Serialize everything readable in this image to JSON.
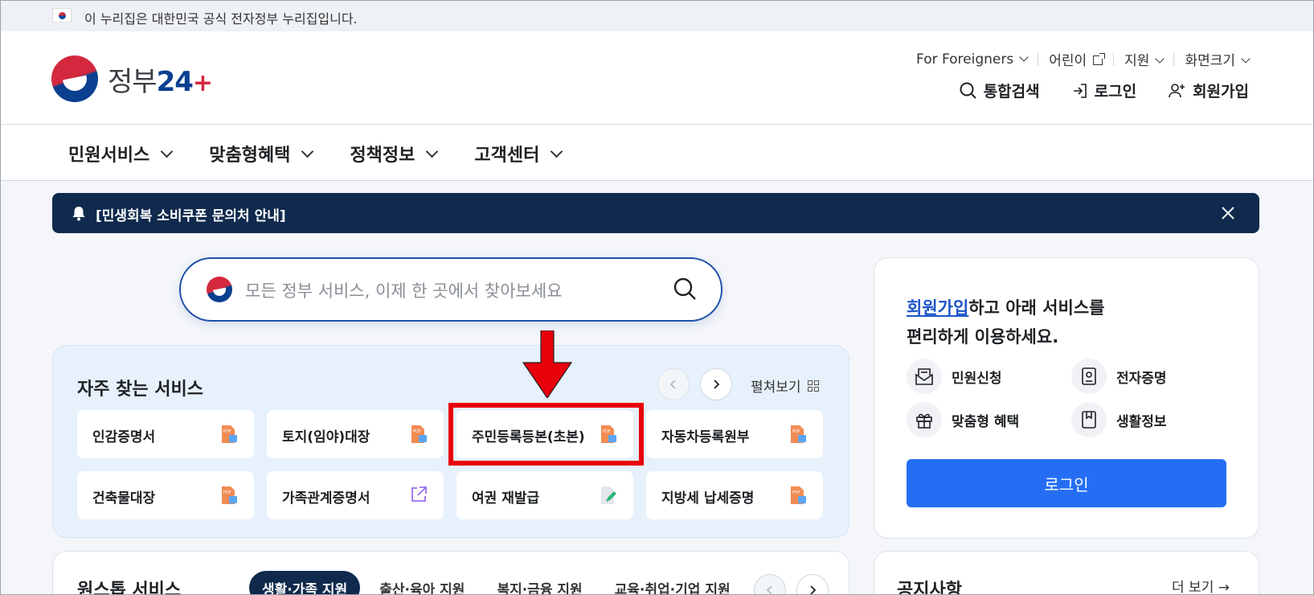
{
  "official_banner": {
    "text": "이 누리집은 대한민국 공식 전자정부 누리집입니다."
  },
  "logo": {
    "text": "정부",
    "number": "24"
  },
  "util_menu": {
    "foreigners": "For Foreigners",
    "kids": "어린이",
    "support": "지원",
    "font_size": "화면크기"
  },
  "auth": {
    "search": "통합검색",
    "login": "로그인",
    "signup": "회원가입"
  },
  "gnb": [
    "민원서비스",
    "맞춤형혜택",
    "정책정보",
    "고객센터"
  ],
  "notice_bar": {
    "text": "[민생회복 소비쿠폰 문의처 안내]"
  },
  "search": {
    "placeholder": "모든 정부 서비스, 이제 한 곳에서 찾아보세요"
  },
  "frequent": {
    "title": "자주 찾는 서비스",
    "expand": "펼쳐보기",
    "tiles": [
      {
        "label": "인감증명서",
        "icon": "pdf-doc-icon"
      },
      {
        "label": "토지(임야)대장",
        "icon": "pdf-doc-icon"
      },
      {
        "label": "주민등록등본(초본)",
        "icon": "pdf-doc-icon"
      },
      {
        "label": "자동차등록원부",
        "icon": "pdf-doc-icon"
      },
      {
        "label": "건축물대장",
        "icon": "pdf-doc-icon"
      },
      {
        "label": "가족관계증명서",
        "icon": "external-link-icon"
      },
      {
        "label": "여권 재발급",
        "icon": "edit-doc-icon"
      },
      {
        "label": "지방세 납세증명",
        "icon": "pdf-doc-icon"
      }
    ]
  },
  "login_card": {
    "link": "회원가입",
    "line1_rest": "하고 아래 서비스를",
    "line2": "편리하게 이용하세요.",
    "services": [
      "민원신청",
      "전자증명",
      "맞춤형 혜택",
      "생활정보"
    ],
    "button": "로그인"
  },
  "onestop": {
    "title": "원스톱 서비스",
    "tabs": [
      "생활·가족 지원",
      "출산·육아 지원",
      "복지·금융 지원",
      "교육·취업·기업 지원"
    ]
  },
  "notices": {
    "title": "공지사항",
    "more": "더 보기 →"
  },
  "colors": {
    "brand_navy": "#0f2a4d",
    "primary_blue": "#256ef4",
    "highlight_red": "#e8000b"
  }
}
